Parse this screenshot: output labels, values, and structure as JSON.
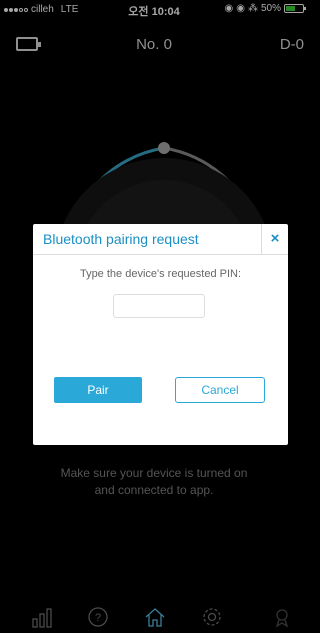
{
  "status_bar": {
    "carrier": "cilleh",
    "network": "LTE",
    "time": "오전 10:04",
    "battery_percent": "50%"
  },
  "header": {
    "title": "No. 0",
    "right_label": "D-0"
  },
  "dialog": {
    "title": "Bluetooth pairing request",
    "close_label": "×",
    "prompt": "Type the device's requested PIN:",
    "pin_value": "",
    "pair_label": "Pair",
    "cancel_label": "Cancel"
  },
  "message": {
    "line1": "Make sure your device is turned on",
    "line2": "and connected to app."
  },
  "tabs": [
    {
      "icon": "bar-chart-icon"
    },
    {
      "icon": "help-icon"
    },
    {
      "icon": "home-icon"
    },
    {
      "icon": "settings-icon"
    },
    {
      "icon": "trophy-icon"
    }
  ],
  "colors": {
    "accent": "#2aa8d8",
    "title_blue": "#1a8fc4",
    "arc_blue": "#3aa6c6"
  }
}
